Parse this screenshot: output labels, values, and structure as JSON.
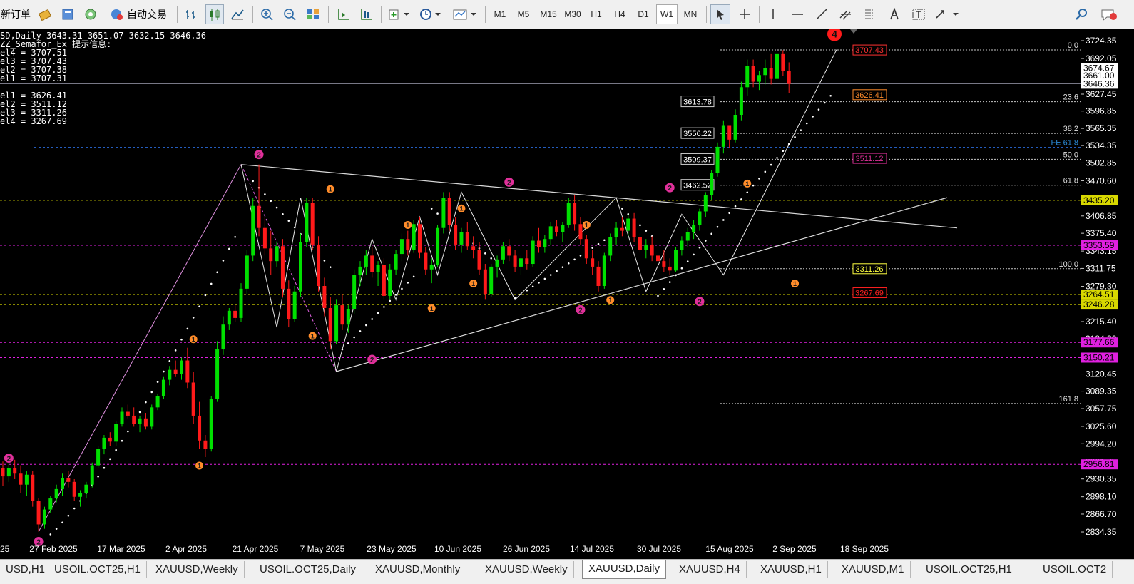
{
  "toolbar": {
    "new_order_label": "新订单",
    "auto_trade_label": "自动交易",
    "timeframes": [
      "M1",
      "M5",
      "M15",
      "M30",
      "H1",
      "H4",
      "D1",
      "W1",
      "MN"
    ],
    "active_timeframe": "W1"
  },
  "chart_info": {
    "symbol_line": "SD,Daily  3643.31 3651.07 3632.15 3646.36",
    "indicator": "ZZ_Semafor_Ex 提示信息:",
    "levels_up": [
      "el4 = 3707.51",
      "el3 = 3707.43",
      "el2 = 3707.38",
      "el1 = 3707.31"
    ],
    "levels_down": [
      "el1 = 3626.41",
      "el2 = 3511.12",
      "el3 = 3311.26",
      "el4 = 3267.69"
    ]
  },
  "chart_data": {
    "type": "candlestick",
    "symbol": "XAUUSD",
    "timeframe": "Daily",
    "ylim": [
      2815,
      3745
    ],
    "price_ticks": [
      "3724.35",
      "3692.05",
      "3659.75",
      "3627.45",
      "3596.85",
      "3565.35",
      "3534.35",
      "3502.85",
      "3470.60",
      "3438.25",
      "3406.85",
      "3375.40",
      "3343.15",
      "3311.75",
      "3279.30",
      "3247.85",
      "3215.40",
      "3184.30",
      "3151.85",
      "3120.45",
      "3089.35",
      "3057.75",
      "3025.60",
      "2994.20",
      "2961.75",
      "2930.35",
      "2898.10",
      "2866.70",
      "2834.35"
    ],
    "price_labels": [
      {
        "price": 3674.67,
        "text": "3674.67",
        "style": "white"
      },
      {
        "price": 3661.0,
        "text": "3661.00",
        "style": "white"
      },
      {
        "price": 3646.36,
        "text": "3646.36",
        "style": "white"
      },
      {
        "price": 3435.2,
        "text": "3435.20",
        "style": "yellow"
      },
      {
        "price": 3353.59,
        "text": "3353.59",
        "style": "magenta"
      },
      {
        "price": 3264.51,
        "text": "3264.51",
        "style": "yellow"
      },
      {
        "price": 3246.28,
        "text": "3246.28",
        "style": "yellow"
      },
      {
        "price": 3177.66,
        "text": "3177.66",
        "style": "magenta"
      },
      {
        "price": 3150.21,
        "text": "3150.21",
        "style": "magenta"
      },
      {
        "price": 2956.81,
        "text": "2956.81",
        "style": "magenta"
      }
    ],
    "date_labels": [
      "25",
      "27 Feb 2025",
      "17 Mar 2025",
      "2 Apr 2025",
      "21 Apr 2025",
      "7 May 2025",
      "23 May 2025",
      "10 Jun 2025",
      "26 Jun 2025",
      "14 Jul 2025",
      "30 Jul 2025",
      "15 Aug 2025",
      "2 Sep 2025",
      "18 Sep 2025"
    ],
    "fib_levels": [
      {
        "price": 3707.51,
        "label": "0.0"
      },
      {
        "price": 3613.78,
        "label": "23.6"
      },
      {
        "price": 3556.22,
        "label": "38.2"
      },
      {
        "price": 3509.37,
        "label": "50.0"
      },
      {
        "price": 3462.52,
        "label": "61.8"
      },
      {
        "price": 3311.26,
        "label": "100.0"
      },
      {
        "price": 3067.0,
        "label": "161.8"
      }
    ],
    "fe_label": "FE 61.8",
    "fib_price_boxes": [
      "3613.78",
      "3556.22",
      "3509.37",
      "3462.52"
    ],
    "semafor_boxes": [
      {
        "text": "3707.43",
        "color": "#ff3030"
      },
      {
        "text": "3626.41",
        "color": "#ff8c2a"
      },
      {
        "text": "3511.12",
        "color": "#e0309a"
      },
      {
        "text": "3311.26",
        "color": "#ffff40"
      },
      {
        "text": "3267.69",
        "color": "#ff2020"
      }
    ],
    "semafor_top_label": "4",
    "candles": [
      [
        2950,
        2962,
        2918,
        2935
      ],
      [
        2935,
        2958,
        2925,
        2950
      ],
      [
        2950,
        2965,
        2930,
        2940
      ],
      [
        2940,
        2955,
        2905,
        2920
      ],
      [
        2920,
        2945,
        2900,
        2938
      ],
      [
        2938,
        2945,
        2880,
        2890
      ],
      [
        2890,
        2895,
        2835,
        2848
      ],
      [
        2848,
        2880,
        2840,
        2875
      ],
      [
        2875,
        2900,
        2868,
        2895
      ],
      [
        2895,
        2920,
        2888,
        2912
      ],
      [
        2912,
        2940,
        2900,
        2932
      ],
      [
        2932,
        2945,
        2915,
        2925
      ],
      [
        2925,
        2930,
        2890,
        2898
      ],
      [
        2898,
        2910,
        2880,
        2905
      ],
      [
        2905,
        2925,
        2895,
        2920
      ],
      [
        2920,
        2960,
        2915,
        2955
      ],
      [
        2955,
        2990,
        2950,
        2985
      ],
      [
        2985,
        3010,
        2975,
        3005
      ],
      [
        3005,
        3015,
        2990,
        2998
      ],
      [
        2998,
        3035,
        2990,
        3030
      ],
      [
        3030,
        3060,
        3025,
        3052
      ],
      [
        3052,
        3065,
        3040,
        3045
      ],
      [
        3045,
        3060,
        3025,
        3030
      ],
      [
        3030,
        3045,
        3015,
        3040
      ],
      [
        3040,
        3050,
        3020,
        3025
      ],
      [
        3025,
        3065,
        3020,
        3060
      ],
      [
        3060,
        3085,
        3055,
        3080
      ],
      [
        3080,
        3115,
        3075,
        3110
      ],
      [
        3110,
        3135,
        3100,
        3128
      ],
      [
        3128,
        3145,
        3115,
        3120
      ],
      [
        3120,
        3150,
        3110,
        3145
      ],
      [
        3145,
        3168,
        3095,
        3105
      ],
      [
        3105,
        3125,
        3030,
        3045
      ],
      [
        3045,
        3070,
        2985,
        3000
      ],
      [
        3000,
        3010,
        2970,
        2985
      ],
      [
        2985,
        3080,
        2980,
        3075
      ],
      [
        3075,
        3180,
        3070,
        3165
      ],
      [
        3165,
        3225,
        3155,
        3210
      ],
      [
        3210,
        3240,
        3200,
        3235
      ],
      [
        3235,
        3245,
        3215,
        3222
      ],
      [
        3222,
        3285,
        3215,
        3275
      ],
      [
        3275,
        3345,
        3265,
        3335
      ],
      [
        3335,
        3440,
        3325,
        3425
      ],
      [
        3425,
        3500,
        3370,
        3385
      ],
      [
        3385,
        3405,
        3335,
        3348
      ],
      [
        3348,
        3380,
        3300,
        3325
      ],
      [
        3325,
        3360,
        3315,
        3352
      ],
      [
        3352,
        3365,
        3260,
        3275
      ],
      [
        3275,
        3290,
        3205,
        3220
      ],
      [
        3220,
        3280,
        3215,
        3270
      ],
      [
        3270,
        3375,
        3260,
        3360
      ],
      [
        3360,
        3440,
        3350,
        3430
      ],
      [
        3430,
        3440,
        3345,
        3355
      ],
      [
        3355,
        3370,
        3270,
        3280
      ],
      [
        3280,
        3295,
        3225,
        3240
      ],
      [
        3240,
        3260,
        3165,
        3180
      ],
      [
        3180,
        3255,
        3175,
        3245
      ],
      [
        3245,
        3265,
        3200,
        3210
      ],
      [
        3210,
        3245,
        3195,
        3238
      ],
      [
        3238,
        3310,
        3230,
        3300
      ],
      [
        3300,
        3325,
        3280,
        3315
      ],
      [
        3315,
        3345,
        3300,
        3335
      ],
      [
        3335,
        3350,
        3295,
        3305
      ],
      [
        3305,
        3325,
        3280,
        3318
      ],
      [
        3318,
        3330,
        3255,
        3262
      ],
      [
        3262,
        3320,
        3255,
        3310
      ],
      [
        3310,
        3345,
        3300,
        3338
      ],
      [
        3338,
        3375,
        3325,
        3365
      ],
      [
        3365,
        3380,
        3335,
        3345
      ],
      [
        3345,
        3400,
        3340,
        3392
      ],
      [
        3392,
        3405,
        3330,
        3340
      ],
      [
        3340,
        3350,
        3300,
        3310
      ],
      [
        3310,
        3330,
        3285,
        3318
      ],
      [
        3318,
        3390,
        3315,
        3385
      ],
      [
        3385,
        3450,
        3375,
        3440
      ],
      [
        3440,
        3450,
        3380,
        3390
      ],
      [
        3390,
        3405,
        3345,
        3355
      ],
      [
        3355,
        3385,
        3340,
        3378
      ],
      [
        3378,
        3395,
        3345,
        3352
      ],
      [
        3352,
        3370,
        3330,
        3345
      ],
      [
        3345,
        3360,
        3300,
        3310
      ],
      [
        3310,
        3320,
        3255,
        3265
      ],
      [
        3265,
        3320,
        3260,
        3315
      ],
      [
        3315,
        3335,
        3295,
        3328
      ],
      [
        3328,
        3360,
        3320,
        3352
      ],
      [
        3352,
        3365,
        3325,
        3335
      ],
      [
        3335,
        3345,
        3305,
        3315
      ],
      [
        3315,
        3335,
        3300,
        3330
      ],
      [
        3330,
        3345,
        3310,
        3320
      ],
      [
        3320,
        3370,
        3315,
        3362
      ],
      [
        3362,
        3385,
        3340,
        3350
      ],
      [
        3350,
        3372,
        3340,
        3365
      ],
      [
        3365,
        3395,
        3355,
        3388
      ],
      [
        3388,
        3400,
        3370,
        3378
      ],
      [
        3378,
        3395,
        3360,
        3390
      ],
      [
        3390,
        3440,
        3385,
        3430
      ],
      [
        3430,
        3445,
        3380,
        3392
      ],
      [
        3392,
        3405,
        3355,
        3365
      ],
      [
        3365,
        3372,
        3320,
        3330
      ],
      [
        3330,
        3345,
        3300,
        3315
      ],
      [
        3315,
        3325,
        3270,
        3280
      ],
      [
        3280,
        3340,
        3275,
        3335
      ],
      [
        3335,
        3375,
        3325,
        3368
      ],
      [
        3368,
        3395,
        3355,
        3385
      ],
      [
        3385,
        3405,
        3370,
        3380
      ],
      [
        3380,
        3410,
        3370,
        3402
      ],
      [
        3402,
        3412,
        3360,
        3368
      ],
      [
        3368,
        3375,
        3340,
        3345
      ],
      [
        3345,
        3365,
        3330,
        3355
      ],
      [
        3355,
        3370,
        3325,
        3335
      ],
      [
        3335,
        3350,
        3315,
        3325
      ],
      [
        3325,
        3345,
        3305,
        3315
      ],
      [
        3315,
        3330,
        3300,
        3308
      ],
      [
        3308,
        3350,
        3305,
        3345
      ],
      [
        3345,
        3370,
        3335,
        3362
      ],
      [
        3362,
        3385,
        3350,
        3378
      ],
      [
        3378,
        3400,
        3365,
        3390
      ],
      [
        3390,
        3420,
        3380,
        3415
      ],
      [
        3415,
        3450,
        3405,
        3445
      ],
      [
        3445,
        3490,
        3435,
        3485
      ],
      [
        3485,
        3540,
        3478,
        3532
      ],
      [
        3532,
        3580,
        3520,
        3570
      ],
      [
        3570,
        3555,
        3530,
        3545
      ],
      [
        3545,
        3600,
        3540,
        3590
      ],
      [
        3590,
        3650,
        3580,
        3640
      ],
      [
        3640,
        3690,
        3625,
        3678
      ],
      [
        3678,
        3690,
        3640,
        3650
      ],
      [
        3650,
        3670,
        3635,
        3662
      ],
      [
        3662,
        3690,
        3645,
        3675
      ],
      [
        3675,
        3700,
        3645,
        3655
      ],
      [
        3655,
        3708,
        3650,
        3700
      ],
      [
        3700,
        3707,
        3660,
        3670
      ],
      [
        3670,
        3685,
        3630,
        3646
      ]
    ],
    "pivots_2": [
      {
        "i": 1,
        "price": 2950,
        "pos": "above"
      },
      {
        "i": 6,
        "price": 2835,
        "pos": "below"
      },
      {
        "i": 43,
        "price": 3500,
        "pos": "above"
      },
      {
        "i": 62,
        "price": 3165,
        "pos": "below"
      },
      {
        "i": 85,
        "price": 3450,
        "pos": "above"
      },
      {
        "i": 97,
        "price": 3255,
        "pos": "below"
      },
      {
        "i": 112,
        "price": 3440,
        "pos": "above"
      },
      {
        "i": 117,
        "price": 3270,
        "pos": "below"
      }
    ],
    "pivots_1": [
      {
        "i": 33,
        "price": 2970,
        "pos": "below"
      },
      {
        "i": 32,
        "price": 3168,
        "pos": "above"
      },
      {
        "i": 52,
        "price": 3205,
        "pos": "below"
      },
      {
        "i": 55,
        "price": 3440,
        "pos": "above"
      },
      {
        "i": 68,
        "price": 3375,
        "pos": "above"
      },
      {
        "i": 72,
        "price": 3255,
        "pos": "below"
      },
      {
        "i": 77,
        "price": 3405,
        "pos": "above"
      },
      {
        "i": 79,
        "price": 3300,
        "pos": "below"
      },
      {
        "i": 98,
        "price": 3375,
        "pos": "above"
      },
      {
        "i": 102,
        "price": 3270,
        "pos": "below"
      },
      {
        "i": 125,
        "price": 3450,
        "pos": "above"
      },
      {
        "i": 133,
        "price": 3300,
        "pos": "below"
      }
    ]
  },
  "tabs": [
    {
      "label": "USD,H1",
      "active": false
    },
    {
      "label": "USOIL.OCT25,H1",
      "active": false
    },
    {
      "label": "XAUUSD,Weekly",
      "active": false
    },
    {
      "label": "USOIL.OCT25,Daily",
      "active": false
    },
    {
      "label": "XAUUSD,Monthly",
      "active": false
    },
    {
      "label": "XAUUSD,Weekly",
      "active": false
    },
    {
      "label": "XAUUSD,Daily",
      "active": true
    },
    {
      "label": "XAUUSD,H4",
      "active": false
    },
    {
      "label": "XAUUSD,H1",
      "active": false
    },
    {
      "label": "XAUUSD,M1",
      "active": false
    },
    {
      "label": "USOIL.OCT25,H1",
      "active": false
    },
    {
      "label": "USOIL.OCT2",
      "active": false
    }
  ]
}
